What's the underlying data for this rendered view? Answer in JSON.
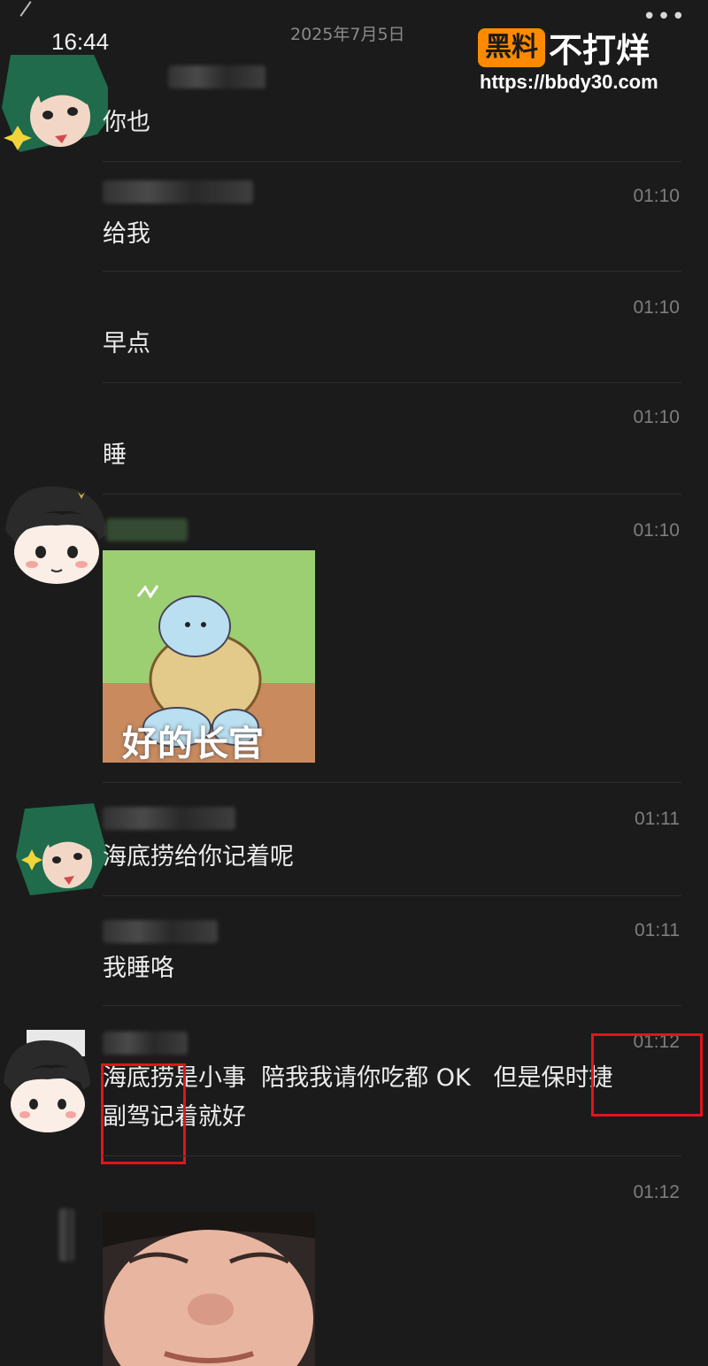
{
  "status": {
    "time": "16:44",
    "date": "2025年7月5日",
    "more": "•••"
  },
  "watermark": {
    "badge": "黑料",
    "text": "不打烊",
    "url": "https://bbdy30.com"
  },
  "messages": [
    {
      "time": "",
      "text": "你也"
    },
    {
      "time": "01:10",
      "text": "给我"
    },
    {
      "time": "01:10",
      "text": "早点"
    },
    {
      "time": "01:10",
      "text": "睡"
    },
    {
      "time": "01:10",
      "sticker_caption": "好的长官"
    },
    {
      "time": "01:11",
      "text": "海底捞给你记着呢"
    },
    {
      "time": "01:11",
      "text": "我睡咯"
    },
    {
      "time": "01:12",
      "text_line1": "海底捞是小事  陪我我请你吃都 OK   但是保时捷",
      "text_line2": "副驾记着就好"
    },
    {
      "time": "01:12"
    }
  ],
  "colors": {
    "background": "#1b1b1b",
    "highlight": "#e0151b",
    "watermark": "#ff8a00"
  }
}
